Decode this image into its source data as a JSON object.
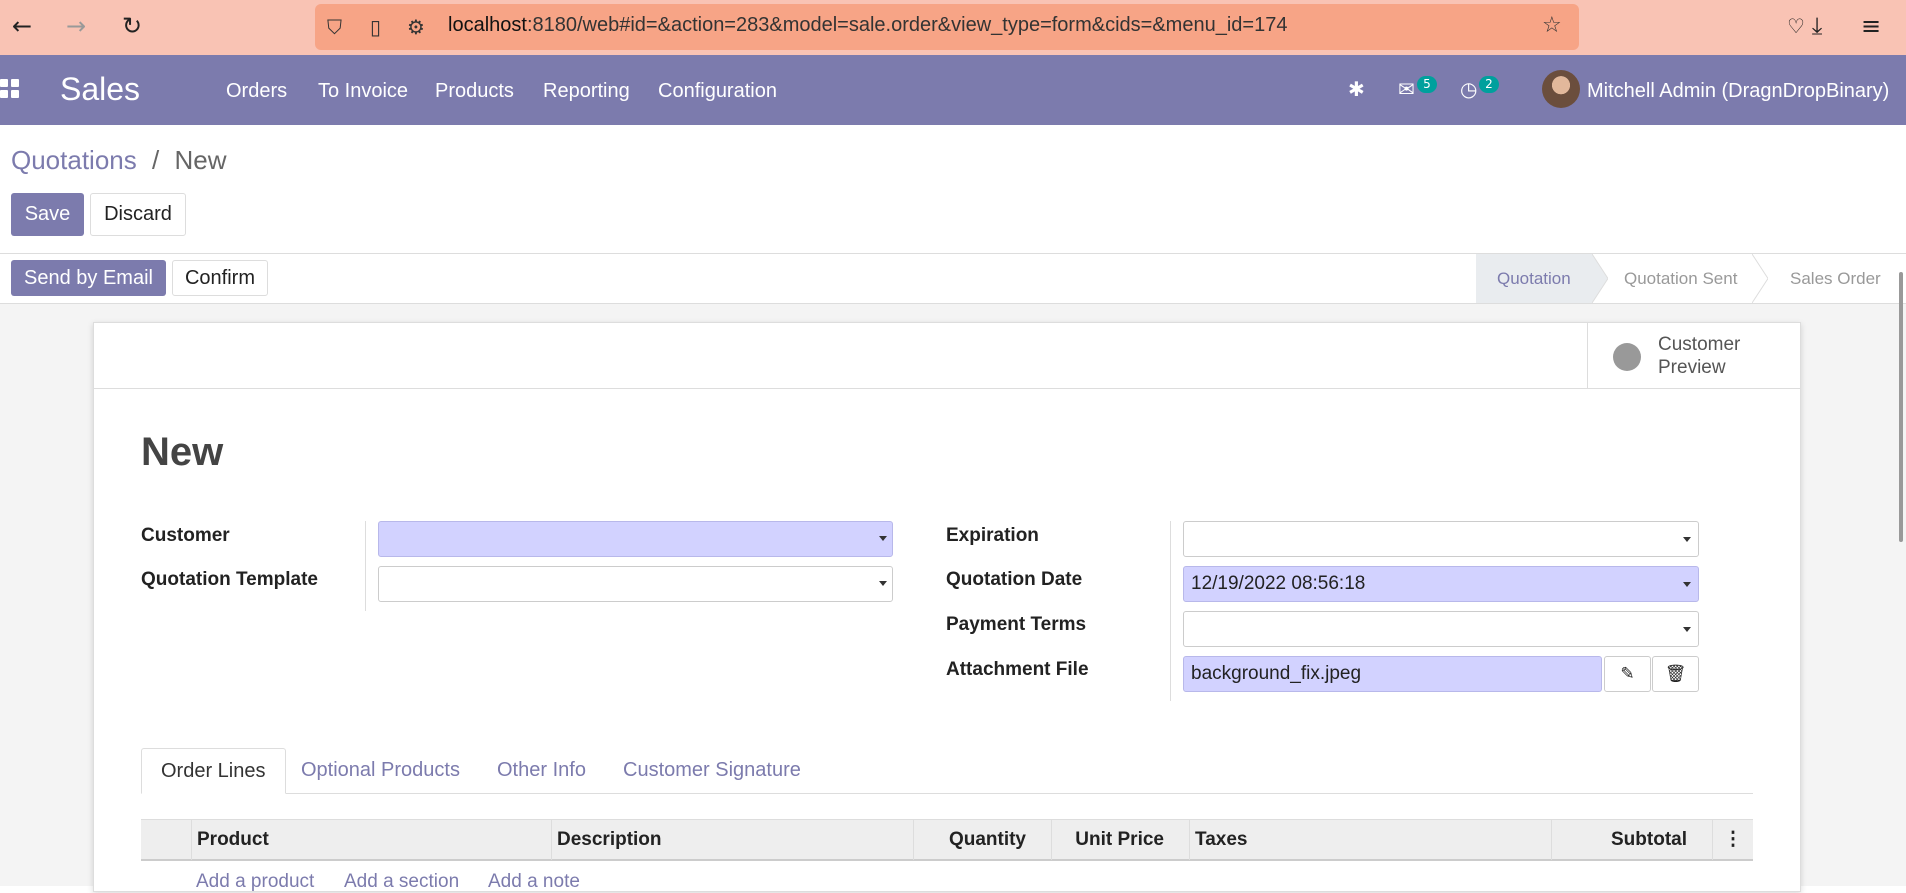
{
  "browser": {
    "url_host": "localhost",
    "url_rest": ":8180/web#id=&action=283&model=sale.order&view_type=form&cids=&menu_id=174"
  },
  "navbar": {
    "app_name": "Sales",
    "menus": [
      "Orders",
      "To Invoice",
      "Products",
      "Reporting",
      "Configuration"
    ],
    "messages_badge": "5",
    "activities_badge": "2",
    "user": "Mitchell Admin (DragnDropBinary)"
  },
  "breadcrumb": {
    "parent": "Quotations",
    "separator": "/",
    "current": "New"
  },
  "control": {
    "save_label": "Save",
    "discard_label": "Discard",
    "send_email_label": "Send by Email",
    "confirm_label": "Confirm"
  },
  "statusbar": {
    "steps": [
      "Quotation",
      "Quotation Sent",
      "Sales Order"
    ],
    "active": "Quotation"
  },
  "sheet": {
    "preview_line1": "Customer",
    "preview_line2": "Preview",
    "title": "New"
  },
  "fields": {
    "customer_label": "Customer",
    "customer_value": "",
    "template_label": "Quotation Template",
    "template_value": "",
    "expiration_label": "Expiration",
    "expiration_value": "",
    "quotation_date_label": "Quotation Date",
    "quotation_date_value": "12/19/2022 08:56:18",
    "payment_terms_label": "Payment Terms",
    "payment_terms_value": "",
    "attachment_label": "Attachment File",
    "attachment_value": "background_fix.jpeg"
  },
  "tabs": [
    "Order Lines",
    "Optional Products",
    "Other Info",
    "Customer Signature"
  ],
  "table": {
    "columns": [
      "Product",
      "Description",
      "Quantity",
      "Unit Price",
      "Taxes",
      "Subtotal"
    ],
    "add_product": "Add a product",
    "add_section": "Add a section",
    "add_note": "Add a note"
  },
  "colors": {
    "brand": "#7c7bad",
    "browser_bar": "#f9c3b4",
    "required_field": "#d2d2ff",
    "badge": "#00a09d"
  }
}
